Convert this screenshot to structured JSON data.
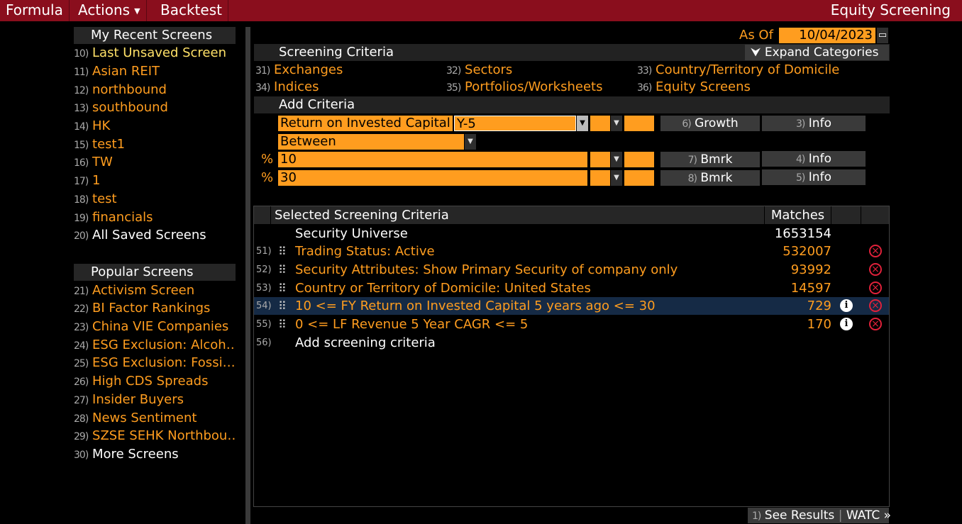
{
  "menu": {
    "formula": "Formula",
    "actions": "Actions",
    "backtest": "Backtest"
  },
  "title": "Equity Screening",
  "recent": {
    "heading": "My Recent Screens",
    "items": [
      {
        "num": "10)",
        "label": "Last Unsaved Screen"
      },
      {
        "num": "11)",
        "label": "Asian REIT"
      },
      {
        "num": "12)",
        "label": "northbound"
      },
      {
        "num": "13)",
        "label": "southbound"
      },
      {
        "num": "14)",
        "label": "HK"
      },
      {
        "num": "15)",
        "label": "test1"
      },
      {
        "num": "16)",
        "label": "TW"
      },
      {
        "num": "17)",
        "label": "1"
      },
      {
        "num": "18)",
        "label": "test"
      },
      {
        "num": "19)",
        "label": "financials"
      },
      {
        "num": "20)",
        "label": "All Saved Screens"
      }
    ]
  },
  "popular": {
    "heading": "Popular Screens",
    "items": [
      {
        "num": "21)",
        "label": "Activism Screen"
      },
      {
        "num": "22)",
        "label": "BI Factor Rankings"
      },
      {
        "num": "23)",
        "label": "China VIE Companies"
      },
      {
        "num": "24)",
        "label": "ESG Exclusion: Alcoh…"
      },
      {
        "num": "25)",
        "label": "ESG Exclusion: Fossi…"
      },
      {
        "num": "26)",
        "label": "High CDS Spreads"
      },
      {
        "num": "27)",
        "label": "Insider Buyers"
      },
      {
        "num": "28)",
        "label": "News Sentiment"
      },
      {
        "num": "29)",
        "label": "SZSE SEHK Northbou…"
      },
      {
        "num": "30)",
        "label": "More Screens"
      }
    ]
  },
  "as_of": {
    "label": "As Of",
    "date": "10/04/2023"
  },
  "screening_criteria": {
    "heading": "Screening Criteria",
    "expand_label": "Expand Categories",
    "categories": [
      {
        "num": "31)",
        "label": "Exchanges"
      },
      {
        "num": "32)",
        "label": "Sectors"
      },
      {
        "num": "33)",
        "label": "Country/Territory of Domicile"
      },
      {
        "num": "34)",
        "label": "Indices"
      },
      {
        "num": "35)",
        "label": "Portfolios/Worksheets"
      },
      {
        "num": "36)",
        "label": "Equity Screens"
      }
    ]
  },
  "add_criteria": {
    "heading": "Add Criteria",
    "field": "Return on Invested Capital",
    "period": "Y-5",
    "operator": "Between",
    "pct_symbol": "%",
    "low": "10",
    "high": "30",
    "growth_btn": {
      "num": "6)",
      "label": "Growth"
    },
    "info1_btn": {
      "num": "3)",
      "label": "Info"
    },
    "bmrk1_btn": {
      "num": "7)",
      "label": "Bmrk"
    },
    "info2_btn": {
      "num": "4)",
      "label": "Info"
    },
    "bmrk2_btn": {
      "num": "8)",
      "label": "Bmrk"
    },
    "info3_btn": {
      "num": "5)",
      "label": "Info"
    }
  },
  "selected": {
    "header": "Selected Screening Criteria",
    "matches_header": "Matches",
    "universe": {
      "label": "Security Universe",
      "matches": "1653154"
    },
    "rows": [
      {
        "num": "51)",
        "label": "Trading Status: Active",
        "matches": "532007"
      },
      {
        "num": "52)",
        "label": "Security Attributes: Show Primary Security of company only",
        "matches": "93992"
      },
      {
        "num": "53)",
        "label": "Country or Territory of Domicile: United States",
        "matches": "14597"
      },
      {
        "num": "54)",
        "label": "10 <= FY Return on Invested Capital 5 years ago <= 30",
        "matches": "729"
      },
      {
        "num": "55)",
        "label": "0 <= LF Revenue 5 Year CAGR <= 5",
        "matches": "170"
      }
    ],
    "add_row": {
      "num": "56)",
      "label": "Add screening criteria"
    }
  },
  "footer": {
    "num": "1)",
    "label": "See Results",
    "extra": "WATC »"
  },
  "colors": {
    "accent": "#ff9d1f",
    "topbar": "#8a0e1d",
    "selected_row": "#152a45",
    "delete": "#e0213a"
  }
}
